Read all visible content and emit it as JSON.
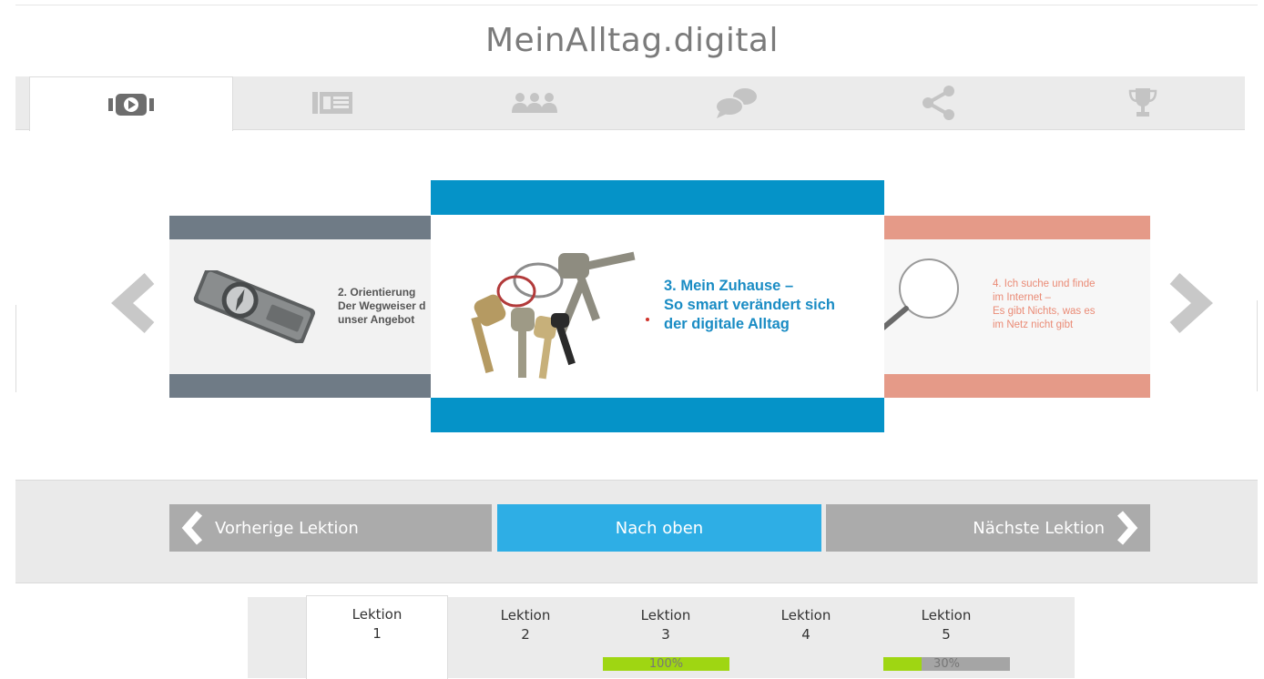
{
  "site": {
    "title": "MeinAlltag.digital"
  },
  "tabs": [
    {
      "icon": "video-play-icon",
      "active": true
    },
    {
      "icon": "newspaper-icon",
      "active": false
    },
    {
      "icon": "group-icon",
      "active": false
    },
    {
      "icon": "speech-bubbles-icon",
      "active": false
    },
    {
      "icon": "share-icon",
      "active": false
    },
    {
      "icon": "trophy-icon",
      "active": false
    }
  ],
  "carousel": {
    "left": {
      "lines": [
        "2. Orientierung",
        "Der Wegweiser d",
        "unser Angebot"
      ],
      "accent": "#6f7b86"
    },
    "center": {
      "lines": [
        "3. Mein Zuhause –",
        "So smart verändert sich",
        "der digitale Alltag"
      ],
      "accent": "#0593c8"
    },
    "right": {
      "lines": [
        "4. Ich suche und finde",
        "im Internet –",
        "Es gibt Nichts, was es",
        "im Netz nicht gibt"
      ],
      "accent": "#e59a88"
    }
  },
  "nav": {
    "prev_label": "Vorherige Lektion",
    "up_label": "Nach oben",
    "next_label": "Nächste Lektion",
    "up_color": "#2eaee5"
  },
  "lessons": [
    {
      "title": "Lektion",
      "number": "1",
      "active": true
    },
    {
      "title": "Lektion",
      "number": "2"
    },
    {
      "title": "Lektion",
      "number": "3",
      "progress": 1.0,
      "progress_label": "100%"
    },
    {
      "title": "Lektion",
      "number": "4"
    },
    {
      "title": "Lektion",
      "number": "5",
      "progress": 0.3,
      "progress_label": "30%"
    }
  ]
}
